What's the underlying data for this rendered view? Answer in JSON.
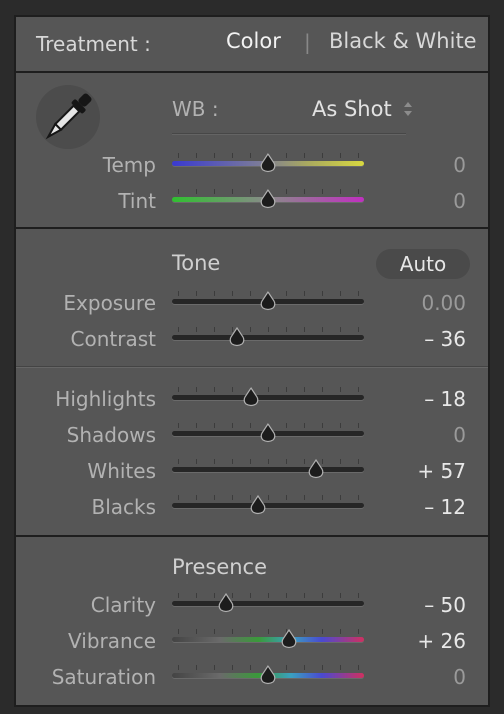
{
  "treatment": {
    "label": "Treatment :",
    "color": "Color",
    "separator": "|",
    "bw": "Black & White"
  },
  "wb": {
    "label": "WB :",
    "value": "As Shot",
    "dropdown_icon": "up-down-arrows-icon",
    "eyedropper_icon": "eyedropper-icon"
  },
  "sliders": {
    "temp": {
      "label": "Temp",
      "value": "0",
      "pos": 0.5,
      "gradient": "temp"
    },
    "tint": {
      "label": "Tint",
      "value": "0",
      "pos": 0.5,
      "gradient": "tint"
    },
    "exposure": {
      "label": "Exposure",
      "value": "0.00",
      "pos": 0.5
    },
    "contrast": {
      "label": "Contrast",
      "value": "– 36",
      "pos": 0.34
    },
    "highlights": {
      "label": "Highlights",
      "value": "– 18",
      "pos": 0.41
    },
    "shadows": {
      "label": "Shadows",
      "value": "0",
      "pos": 0.5
    },
    "whites": {
      "label": "Whites",
      "value": "+ 57",
      "pos": 0.75
    },
    "blacks": {
      "label": "Blacks",
      "value": "– 12",
      "pos": 0.45
    },
    "clarity": {
      "label": "Clarity",
      "value": "– 50",
      "pos": 0.28
    },
    "vibrance": {
      "label": "Vibrance",
      "value": "+ 26",
      "pos": 0.61,
      "gradient": "color"
    },
    "saturation": {
      "label": "Saturation",
      "value": "0",
      "pos": 0.5,
      "gradient": "color"
    }
  },
  "tone": {
    "title": "Tone",
    "auto": "Auto"
  },
  "presence": {
    "title": "Presence"
  },
  "colors": {
    "panel": "#565656",
    "text_dim": "#b2b2b2",
    "text_bright": "#e8e8e8"
  }
}
